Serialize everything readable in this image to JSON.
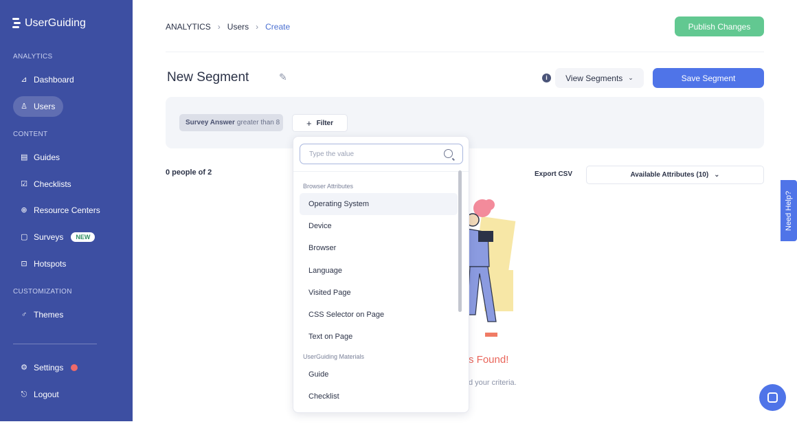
{
  "sidebar": {
    "brand": "UserGuiding",
    "sections": {
      "analytics": "ANALYTICS",
      "content": "CONTENT",
      "customization": "CUSTOMIZATION"
    },
    "items": {
      "dashboard": "Dashboard",
      "users": "Users",
      "guides": "Guides",
      "checklists": "Checklists",
      "resource_centers": "Resource Centers",
      "surveys": "Surveys",
      "surveys_badge": "NEW",
      "hotspots": "Hotspots",
      "themes": "Themes",
      "settings": "Settings",
      "logout": "Logout"
    }
  },
  "breadcrumb": [
    "ANALYTICS",
    "Users",
    "Create"
  ],
  "header": {
    "publish_label": "Publish Changes"
  },
  "segment": {
    "title": "New Segment",
    "view_segments_label": "View Segments",
    "save_label": "Save Segment"
  },
  "filter": {
    "chip_attr": "Survey Answer",
    "chip_op": "greater than 8",
    "add_filter_label": "Filter"
  },
  "results": {
    "count_text": "0 people of 2",
    "export_label": "Export CSV",
    "attributes_label": "Available Attributes (10)"
  },
  "empty_state": {
    "title_fragment": "s Found!",
    "subtitle_fragment": "d your criteria."
  },
  "dropdown": {
    "search_placeholder": "Type the value",
    "groups": [
      {
        "label": "Browser Attributes",
        "items": [
          "Operating System",
          "Device",
          "Browser",
          "Language",
          "Visited Page",
          "CSS Selector on Page",
          "Text on Page"
        ]
      },
      {
        "label": "UserGuiding Materials",
        "items": [
          "Guide",
          "Checklist"
        ]
      }
    ]
  },
  "help": {
    "need_help_label": "Need Help?"
  },
  "colors": {
    "sidebar_bg": "#3d4fa2",
    "primary": "#4f74e8",
    "publish": "#62c891",
    "danger": "#e9655a"
  }
}
